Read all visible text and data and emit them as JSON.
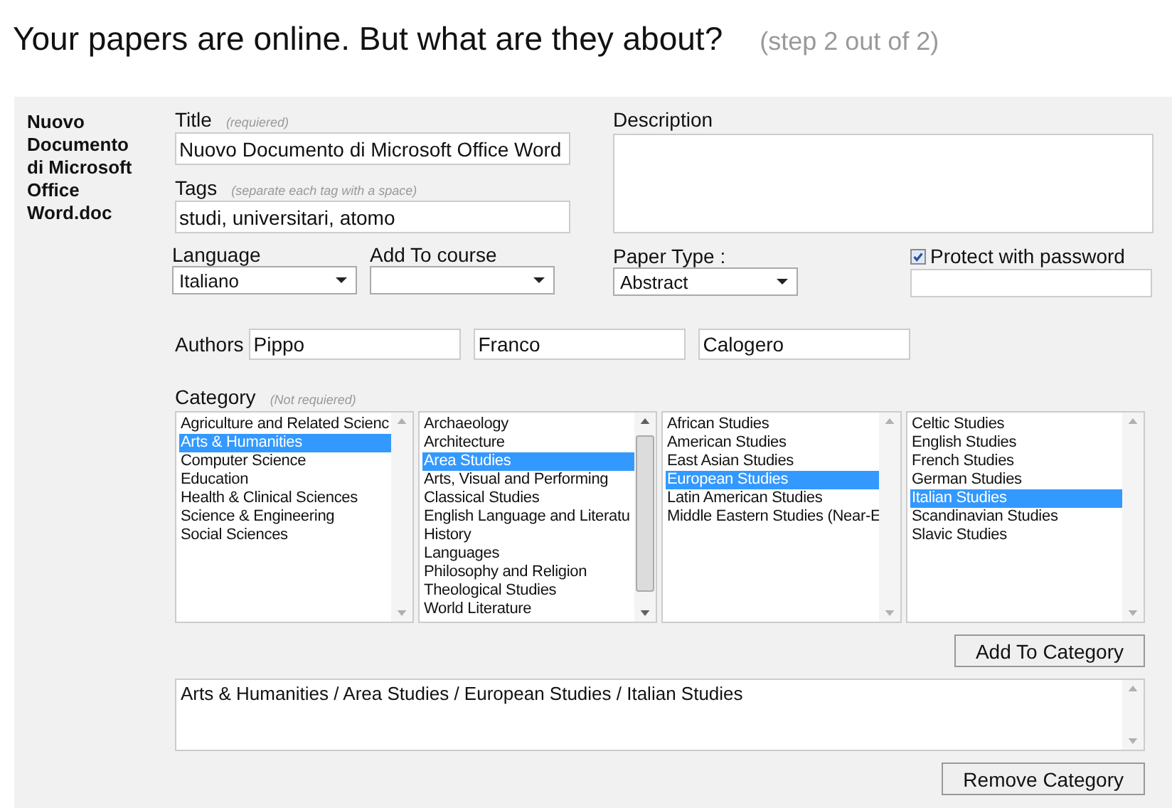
{
  "header": {
    "title": "Your papers are online. But what are they about?",
    "step": "(step 2 out of 2)"
  },
  "file_name": "Nuovo Documento di Microsoft Office Word.doc",
  "title_field": {
    "label": "Title",
    "hint": "(requiered)",
    "value": "Nuovo Documento di Microsoft Office Word"
  },
  "tags_field": {
    "label": "Tags",
    "hint": "(separate each tag with a space)",
    "value": "studi, universitari, atomo"
  },
  "language": {
    "label": "Language",
    "value": "Italiano"
  },
  "course": {
    "label": "Add To course"
  },
  "description": {
    "label": "Description"
  },
  "paper_type": {
    "label": "Paper Type :",
    "value": "Abstract"
  },
  "protect": {
    "label": "Protect with password",
    "checked": true
  },
  "authors": {
    "label": "Authors",
    "names": [
      "Pippo",
      "Franco",
      "Calogero"
    ]
  },
  "category": {
    "label": "Category",
    "hint": "(Not requiered)"
  },
  "category_lists": [
    {
      "scrollable": false,
      "items": [
        {
          "label": "Agriculture and Related Scienc",
          "selected": false
        },
        {
          "label": "Arts & Humanities",
          "selected": true
        },
        {
          "label": "Computer Science",
          "selected": false
        },
        {
          "label": "Education",
          "selected": false
        },
        {
          "label": "Health & Clinical Sciences",
          "selected": false
        },
        {
          "label": "Science & Engineering",
          "selected": false
        },
        {
          "label": "Social Sciences",
          "selected": false
        }
      ]
    },
    {
      "scrollable": true,
      "items": [
        {
          "label": "Archaeology",
          "selected": false
        },
        {
          "label": "Architecture",
          "selected": false
        },
        {
          "label": "Area Studies",
          "selected": true
        },
        {
          "label": "Arts, Visual and Performing",
          "selected": false
        },
        {
          "label": "Classical Studies",
          "selected": false
        },
        {
          "label": "English Language and Literatu",
          "selected": false
        },
        {
          "label": "History",
          "selected": false
        },
        {
          "label": "Languages",
          "selected": false
        },
        {
          "label": "Philosophy and Religion",
          "selected": false
        },
        {
          "label": "Theological Studies",
          "selected": false
        },
        {
          "label": "World Literature",
          "selected": false
        }
      ]
    },
    {
      "scrollable": false,
      "items": [
        {
          "label": "African Studies",
          "selected": false
        },
        {
          "label": "American Studies",
          "selected": false
        },
        {
          "label": "East Asian Studies",
          "selected": false
        },
        {
          "label": "European Studies",
          "selected": true
        },
        {
          "label": "Latin American Studies",
          "selected": false
        },
        {
          "label": "Middle Eastern Studies (Near-E",
          "selected": false
        }
      ]
    },
    {
      "scrollable": false,
      "items": [
        {
          "label": "Celtic Studies",
          "selected": false
        },
        {
          "label": "English Studies",
          "selected": false
        },
        {
          "label": "French Studies",
          "selected": false
        },
        {
          "label": "German Studies",
          "selected": false
        },
        {
          "label": "Italian Studies",
          "selected": true
        },
        {
          "label": "Scandinavian Studies",
          "selected": false
        },
        {
          "label": "Slavic Studies",
          "selected": false
        }
      ]
    }
  ],
  "add_button": "Add To Category",
  "selected_categories": [
    "Arts & Humanities / Area Studies / European Studies / Italian Studies"
  ],
  "remove_button": "Remove Category"
}
